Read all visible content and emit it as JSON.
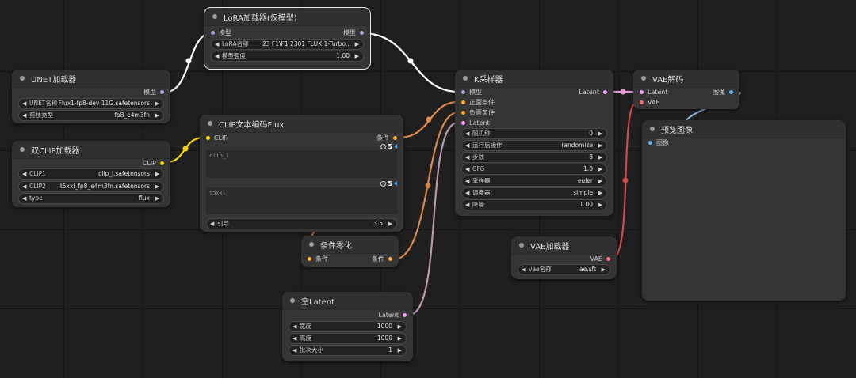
{
  "colors": {
    "model": "#b39ddb",
    "clip": "#ffd500",
    "conditioning": "#ffa931",
    "latent": "#ff9cf9",
    "vae": "#ff6e6e",
    "image": "#64b5f6"
  },
  "nodes": {
    "unet": {
      "title": "UNET加载器",
      "out_model": "模型",
      "w_unet_label": "UNET名称",
      "w_unet_value": "Flux1-fp8-dev 11G.safetensors",
      "w_dtype_label": "剪枝类型",
      "w_dtype_value": "fp8_e4m3fn"
    },
    "dualclip": {
      "title": "双CLIP加载器",
      "out_clip": "CLIP",
      "w_clip1_label": "CLIP1",
      "w_clip1_value": "clip_l.safetensors",
      "w_clip2_label": "CLIP2",
      "w_clip2_value": "t5xxl_fp8_e4m3fn.safetensors",
      "w_type_label": "type",
      "w_type_value": "flux"
    },
    "lora": {
      "title": "LoRA加载器(仅模型)",
      "in_model": "模型",
      "out_model": "模型",
      "w_name_label": "LoRA名称",
      "w_name_value": "23 F1\\F1 2301 FLUX.1-Turbo...",
      "w_strength_label": "模型强度",
      "w_strength_value": "1.00"
    },
    "clipencode": {
      "title": "CLIP文本编码Flux",
      "in_clip": "CLIP",
      "out_cond": "条件",
      "text1": "clip_l",
      "text2": "t5xxl",
      "w_guidance_label": "引导",
      "w_guidance_value": "3.5"
    },
    "zeroout": {
      "title": "条件零化",
      "in_cond": "条件",
      "out_cond": "条件"
    },
    "emptylatent": {
      "title": "空Latent",
      "out_latent": "Latent",
      "w_width_label": "宽度",
      "w_width_value": "1000",
      "w_height_label": "高度",
      "w_height_value": "1000",
      "w_batch_label": "批次大小",
      "w_batch_value": "1"
    },
    "ksampler": {
      "title": "K采样器",
      "in_model": "模型",
      "in_positive": "正面条件",
      "in_negative": "负面条件",
      "in_latent": "Latent",
      "out_latent": "Latent",
      "w_seed_label": "随机种",
      "w_seed_value": "0",
      "w_after_label": "运行后操作",
      "w_after_value": "randomize",
      "w_steps_label": "步数",
      "w_steps_value": "8",
      "w_cfg_label": "CFG",
      "w_cfg_value": "1.0",
      "w_sampler_label": "采样器",
      "w_sampler_value": "euler",
      "w_scheduler_label": "调度器",
      "w_scheduler_value": "simple",
      "w_denoise_label": "降噪",
      "w_denoise_value": "1.00"
    },
    "vaeloader": {
      "title": "VAE加载器",
      "out_vae": "VAE",
      "w_vae_label": "vae名称",
      "w_vae_value": "ae.sft"
    },
    "vaedecode": {
      "title": "VAE解码",
      "in_latent": "Latent",
      "in_vae": "VAE",
      "out_image": "图像"
    },
    "preview": {
      "title": "预览图像",
      "in_image": "图像"
    }
  }
}
